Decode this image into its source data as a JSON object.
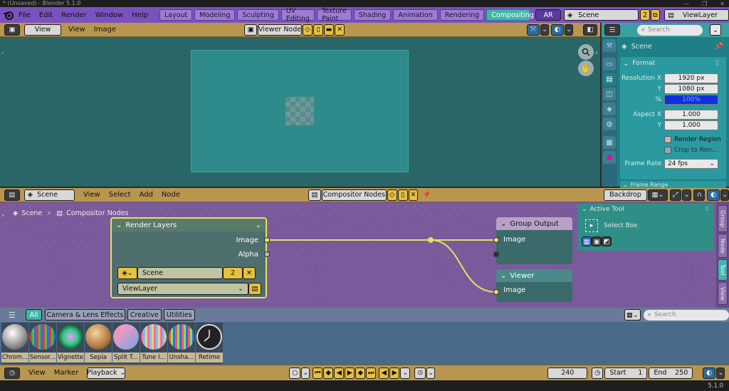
{
  "window": {
    "title": "* (Unsaved) - Blender 5.1.0",
    "controls": [
      "—",
      "❐",
      "✕"
    ]
  },
  "topbar": {
    "menus": [
      "File",
      "Edit",
      "Render",
      "Window",
      "Help"
    ],
    "workspaces": [
      "Layout",
      "Modeling",
      "Sculpting",
      "UV Editing",
      "Texture Paint",
      "Shading",
      "Animation",
      "Rendering",
      "Compositing"
    ],
    "active_workspace": "Compositing",
    "ar_label": "AR",
    "scene": "Scene",
    "scene_users": "2",
    "view_layer": "ViewLayer"
  },
  "image_editor": {
    "view_menu": "View",
    "menus": [
      "View",
      "Image"
    ],
    "image_name": "Viewer Node"
  },
  "properties": {
    "search_placeholder": "Search",
    "context": "Scene",
    "panel_format": "Format",
    "rows": [
      {
        "label": "Resolution X",
        "value": "1920 px"
      },
      {
        "label": "Y",
        "value": "1080 px"
      },
      {
        "label": "%",
        "value": "100%"
      },
      {
        "label": "Aspect X",
        "value": "1.000"
      },
      {
        "label": "Y",
        "value": "1.000"
      }
    ],
    "render_region": "Render Region",
    "crop": "Crop to Ren...",
    "frame_rate_label": "Frame Rate",
    "frame_rate": "24 fps",
    "panel_frame_range": "Frame Range"
  },
  "node_editor": {
    "scene": "Scene",
    "menus": [
      "View",
      "Select",
      "Add",
      "Node"
    ],
    "tree_name": "Compositor Nodes",
    "backdrop": "Backdrop",
    "breadcrumb": [
      "Scene",
      "Compositor Nodes"
    ],
    "render_layers": {
      "title": "Render Layers",
      "outputs": [
        "Image",
        "Alpha"
      ],
      "scene": "Scene",
      "scene_users": "2",
      "view_layer": "ViewLayer"
    },
    "group_output": {
      "title": "Group Output",
      "input": "Image"
    },
    "viewer": {
      "title": "Viewer",
      "input": "Image"
    },
    "active_tool": {
      "title": "Active Tool",
      "tool": "Select Box"
    },
    "side_tabs": [
      "Group",
      "Node",
      "Tool",
      "View"
    ],
    "active_side_tab": "Tool"
  },
  "asset_shelf": {
    "tabs": [
      "All",
      "Camera & Lens Effects",
      "Creative",
      "Utilities"
    ],
    "active_tab": "All",
    "search_placeholder": "Search",
    "items": [
      "Chrom...",
      "Sensor...",
      "Vignette",
      "Sepia",
      "Split T...",
      "Tune I...",
      "Unsha...",
      "Retime"
    ]
  },
  "timeline": {
    "menus": [
      "View",
      "Marker"
    ],
    "playback": "Playback",
    "current_frame": "240",
    "start_label": "Start",
    "start": "1",
    "end_label": "End",
    "end": "250"
  },
  "status": {
    "version": "5.1.0"
  },
  "colors": {
    "topbar": "#7a52c0",
    "header": "#b8964e",
    "accent": "#3fb6a8",
    "node_link": "#e8e060",
    "viewport": "#2a6668"
  }
}
